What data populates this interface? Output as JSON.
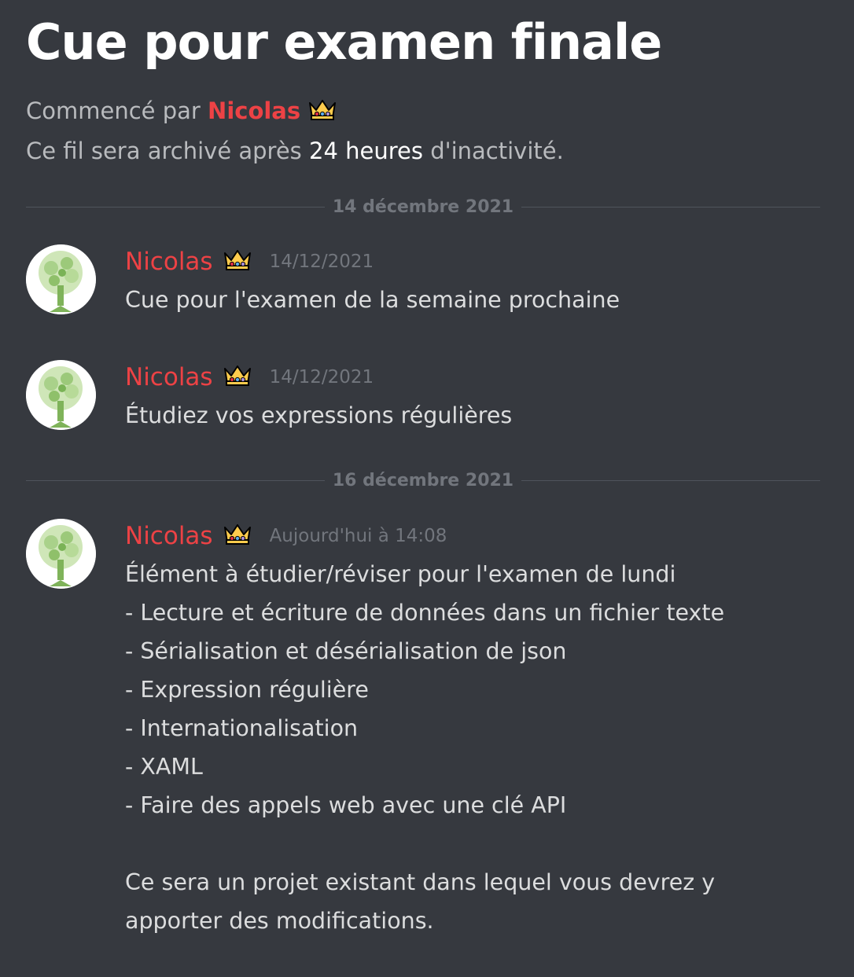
{
  "thread": {
    "title": "Cue pour examen finale",
    "started_by_prefix": "Commencé par",
    "started_by_author": "Nicolas",
    "archive_prefix": "Ce fil sera archivé après",
    "archive_duration": "24 heures",
    "archive_suffix": "d'inactivité."
  },
  "colors": {
    "background": "#36393f",
    "author": "#ed4245",
    "muted": "#72767d",
    "text": "#dcddde"
  },
  "dividers": [
    {
      "date": "14 décembre 2021"
    },
    {
      "date": "16 décembre 2021"
    }
  ],
  "messages": [
    {
      "author": "Nicolas",
      "author_badge": "crown-emoji",
      "timestamp": "14/12/2021",
      "lines": [
        "Cue pour l'examen de la semaine prochaine"
      ]
    },
    {
      "author": "Nicolas",
      "author_badge": "crown-emoji",
      "timestamp": "14/12/2021",
      "lines": [
        "Étudiez vos expressions régulières"
      ]
    },
    {
      "author": "Nicolas",
      "author_badge": "crown-emoji",
      "timestamp": "Aujourd'hui à 14:08",
      "lines": [
        "Élément à étudier/réviser pour l'examen de lundi",
        "- Lecture et écriture de données dans un fichier texte",
        "- Sérialisation et désérialisation de json",
        "- Expression régulière",
        "- Internationalisation",
        "- XAML",
        "- Faire des appels web avec une clé API",
        "",
        "Ce sera un projet existant dans lequel vous devrez y",
        "apporter des modifications."
      ]
    }
  ]
}
